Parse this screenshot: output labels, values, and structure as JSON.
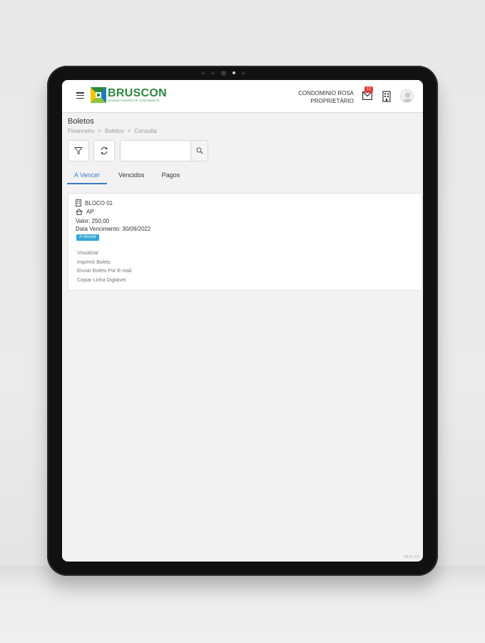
{
  "header": {
    "logo_name": "BRUSCON",
    "logo_subtitle": "ADMINISTRADORA DE CONDOMÍNIOS",
    "condominium": "CONDOMINIO ROSA",
    "role": "PROPRIETÁRIO",
    "mail_badge": "12",
    "icons": [
      "menu-icon",
      "mail-icon",
      "building-icon",
      "user-avatar-icon"
    ]
  },
  "page": {
    "title": "Boletos",
    "breadcrumb": [
      "Financeiro",
      ">",
      "Boletos",
      ">",
      "Consulta"
    ]
  },
  "toolbar": {
    "icons": [
      "filter-icon",
      "refresh-icon",
      "search-icon"
    ],
    "search_value": "",
    "search_placeholder": ""
  },
  "tabs": [
    {
      "label": "A Vencer",
      "active": true
    },
    {
      "label": "Vencidos",
      "active": false
    },
    {
      "label": "Pagos",
      "active": false
    }
  ],
  "boleto": {
    "bloco": "BLOCO 01",
    "unidade": "AP",
    "valor": "Valor: 250,00",
    "vencimento": "Data Vencimento: 30/09/2022",
    "status": "A Vencer",
    "actions": [
      "Visualizar",
      "Imprimir Boleto",
      "Enviar Boleto Por E-mail",
      "Copiar Linha Digitável"
    ]
  },
  "footer": {
    "version": "V0.07.127"
  },
  "colors": {
    "brand_green": "#2a8a3e",
    "accent_blue": "#3b7dc0",
    "status_blue": "#34a6d8",
    "badge_red": "#e23c3c"
  }
}
